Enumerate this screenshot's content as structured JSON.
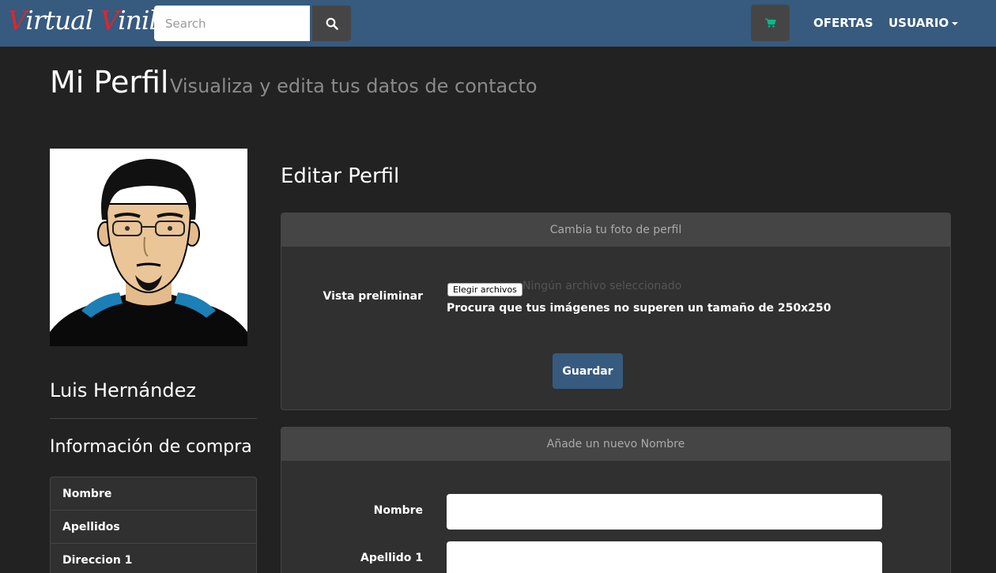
{
  "navbar": {
    "brand_part1_initial": "V",
    "brand_part1_rest": "irtual ",
    "brand_part2_initial": "V",
    "brand_part2_rest": "inilo",
    "search_placeholder": "Search",
    "search_icon": "search-icon",
    "cart_icon": "shopping-cart-icon",
    "offers_label": "OFERTAS",
    "user_label": "USUARIO",
    "accent_color": "#375a7f",
    "brand_red": "#e3232c",
    "cart_color": "#00bc8c"
  },
  "header": {
    "title": "Mi Perfil",
    "subtitle": "Visualiza y edita tus datos de contacto"
  },
  "sidebar": {
    "user_name": "Luis Hernández",
    "section_title": "Información de compra",
    "items": [
      {
        "label": "Nombre"
      },
      {
        "label": "Apellidos"
      },
      {
        "label": "Direccion 1"
      }
    ]
  },
  "main": {
    "edit_title": "Editar Perfil",
    "photo_panel": {
      "heading": "Cambia tu foto de perfil",
      "preview_label": "Vista preliminar",
      "file_button": "Elegir archivos",
      "file_status": "Ningún archivo seleccionado",
      "help": "Procura que tus imágenes no superen un tamaño de 250x250",
      "save_label": "Guardar"
    },
    "name_panel": {
      "heading": "Añade un nuevo Nombre",
      "fields": [
        {
          "label": "Nombre",
          "value": ""
        },
        {
          "label": "Apellido 1",
          "value": ""
        }
      ]
    }
  }
}
